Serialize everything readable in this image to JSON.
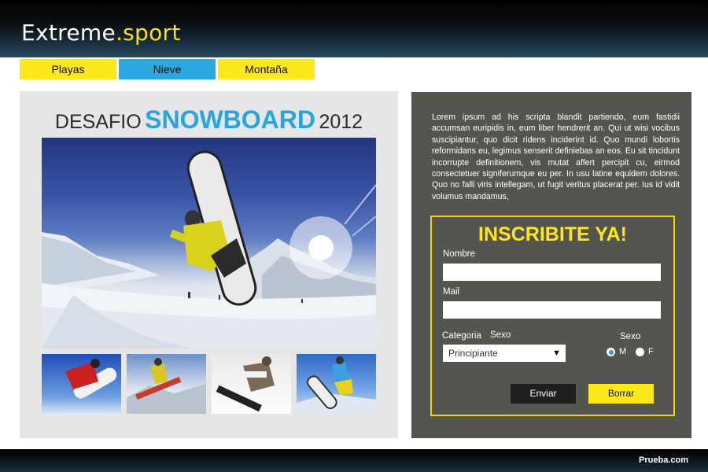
{
  "header": {
    "logo_main": "Extreme",
    "logo_accent": ".sport"
  },
  "nav": {
    "items": [
      {
        "label": "Playas"
      },
      {
        "label": "Nieve"
      },
      {
        "label": "Montaña"
      }
    ]
  },
  "promo": {
    "headline_prefix": "DESAFIO",
    "headline_main": "SNOWBOARD",
    "headline_year": "2012"
  },
  "info": {
    "text": "Lorem ipsum ad his scripta blandit partiendo, eum fastidii accumsan euripidis in, eum liber hendrerit an. Qui ut wisi vocibus suscipiantur, quo dicit ridens inciderint id. Quo mundi lobortis reformidans eu, legimus senserit definiebas an eos. Eu sit tincidunt incorrupte definitionem, vis mutat affert percipit cu, eirmod consectetuer signiferumque eu per. In usu latine equidem dolores. Quo no falli viris intellegam, ut fugit veritus placerat per. Ius id vidit volumus mandamus,"
  },
  "form": {
    "title": "INSCRIBITE YA!",
    "name_label": "Nombre",
    "name_value": "",
    "mail_label": "Mail",
    "mail_value": "",
    "category_label": "Categoria",
    "category_sexo_label": "Sexo",
    "category_selected": "Principiante",
    "sex_label": "Sexo",
    "sex_options": [
      {
        "label": "M",
        "checked": true
      },
      {
        "label": "F",
        "checked": false
      }
    ],
    "submit_label": "Enviar",
    "reset_label": "Borrar"
  },
  "footer": {
    "brand": "Prueba.com"
  },
  "colors": {
    "accent_blue": "#2aa8e0",
    "accent_yellow": "#fce81b",
    "panel_dark": "#555550"
  }
}
